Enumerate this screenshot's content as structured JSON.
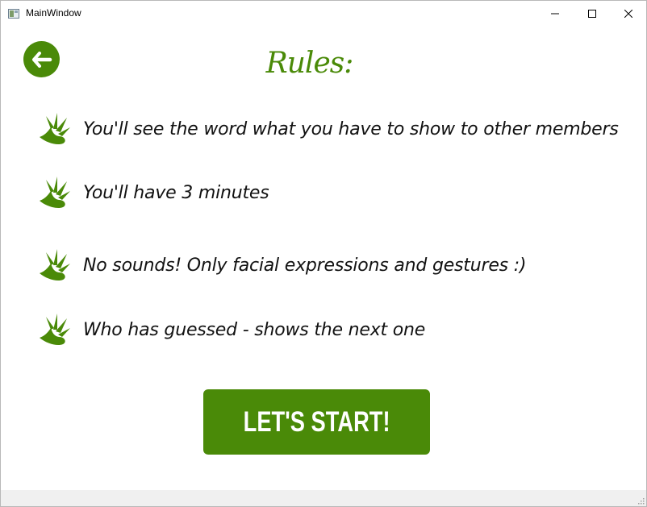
{
  "window": {
    "title": "MainWindow",
    "controls": {
      "minimize_icon": "minimize-icon",
      "maximize_icon": "maximize-icon",
      "close_icon": "close-icon"
    }
  },
  "header": {
    "back_icon": "arrow-left-icon",
    "title": "Rules:"
  },
  "rules": [
    {
      "icon": "dino-footprint-icon",
      "text": "You'll see the word what you have to show to other members"
    },
    {
      "icon": "dino-footprint-icon",
      "text": "You'll have 3 minutes"
    },
    {
      "icon": "dino-footprint-icon",
      "text": "No sounds! Only facial expressions and gestures :)"
    },
    {
      "icon": "dino-footprint-icon",
      "text": "Who has guessed - shows the next one"
    }
  ],
  "start_button": {
    "label": "LET'S START!"
  },
  "colors": {
    "accent": "#4a8a08",
    "text": "#111111",
    "statusbar": "#f0f0f0"
  }
}
